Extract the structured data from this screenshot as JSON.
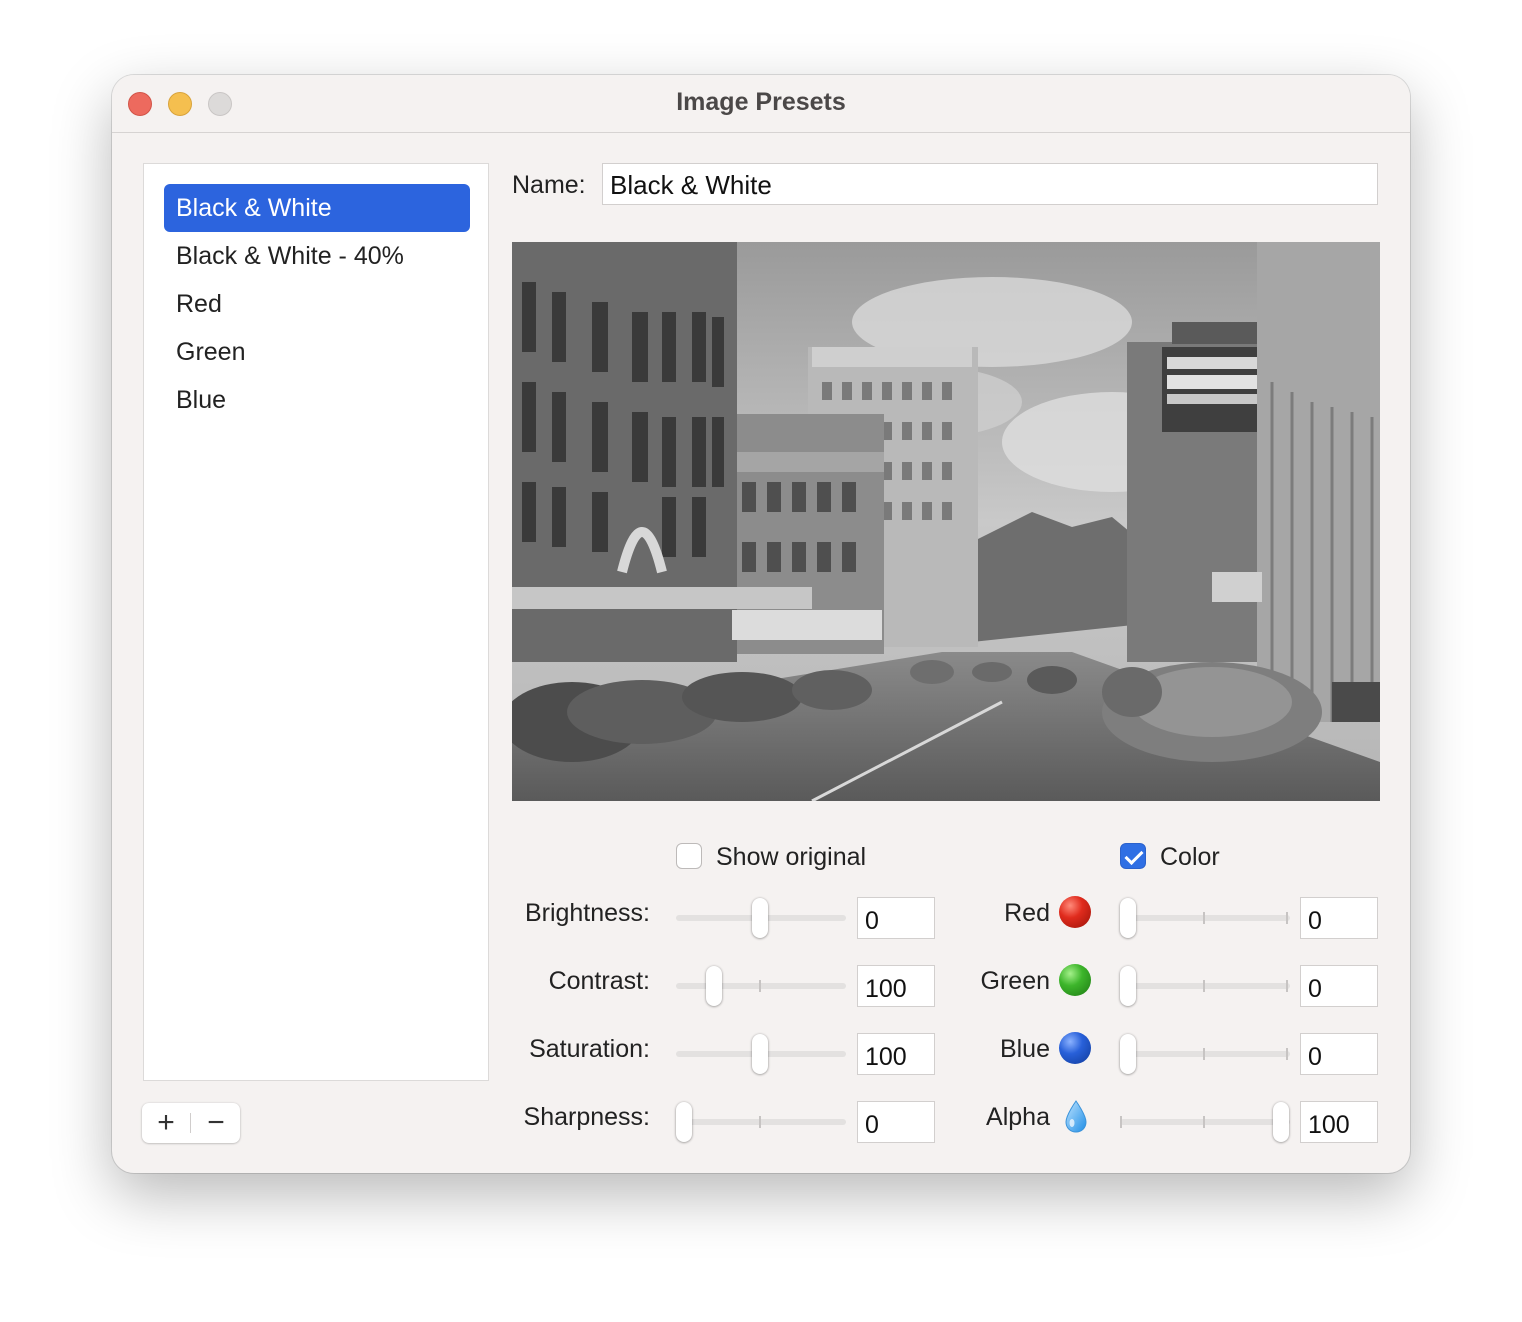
{
  "window": {
    "title": "Image Presets"
  },
  "presets": {
    "items": [
      "Black & White",
      "Black & White - 40%",
      "Red",
      "Green",
      "Blue"
    ],
    "selected_index": 0,
    "add_label": "+",
    "remove_label": "−"
  },
  "editor": {
    "name_label": "Name:",
    "name_value": "Black & White",
    "show_original_label": "Show original",
    "show_original_checked": false,
    "color_label": "Color",
    "color_checked": true
  },
  "adjustments": {
    "brightness": {
      "label": "Brightness:",
      "value": "0",
      "slider_fraction": 0.5
    },
    "contrast": {
      "label": "Contrast:",
      "value": "100",
      "slider_fraction": 0.25
    },
    "saturation": {
      "label": "Saturation:",
      "value": "100",
      "slider_fraction": 0.5
    },
    "sharpness": {
      "label": "Sharpness:",
      "value": "0",
      "slider_fraction": 0.0
    }
  },
  "color_channels": {
    "red": {
      "label": "Red",
      "value": "0",
      "slider_fraction": 0.0,
      "icon": "red-ball-icon"
    },
    "green": {
      "label": "Green",
      "value": "0",
      "slider_fraction": 0.0,
      "icon": "green-ball-icon"
    },
    "blue": {
      "label": "Blue",
      "value": "0",
      "slider_fraction": 0.0,
      "icon": "blue-ball-icon"
    },
    "alpha": {
      "label": "Alpha",
      "value": "100",
      "slider_fraction": 1.0,
      "icon": "droplet-icon"
    }
  },
  "colors": {
    "accent": "#2c64de",
    "checkbox_accent": "#2f6fe4",
    "window_bg": "#f5f2f1"
  }
}
